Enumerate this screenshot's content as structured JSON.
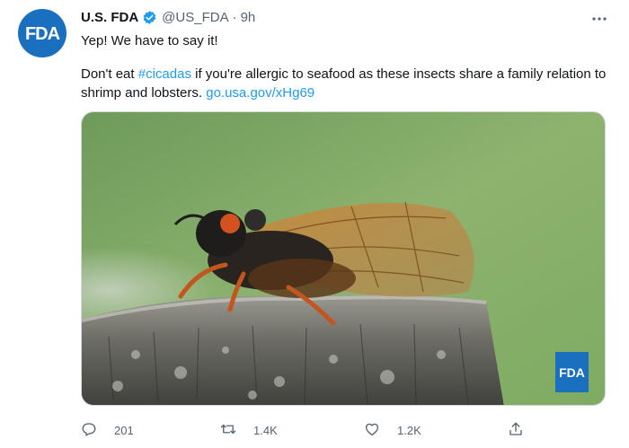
{
  "tweet": {
    "author": {
      "display_name": "U.S. FDA",
      "handle": "@US_FDA",
      "avatar_logo": "FDA",
      "verified_icon": "verified-badge-icon"
    },
    "time_ago": "9h",
    "separator": "·",
    "text_line1": "Yep! We have to say it!",
    "text_line2_start": "Don't eat ",
    "hashtag": "#cicadas",
    "text_line2_rest": " if you're allergic to seafood as these insects share a family relation to shrimp and lobsters. ",
    "url": "go.usa.gov/xHg69",
    "media": {
      "watermark": "FDA"
    },
    "actions": {
      "reply_count": "201",
      "retweet_count": "1.4K",
      "like_count": "1.2K"
    },
    "colors": {
      "link": "#1d9bf0",
      "verified": "#1d9bf0",
      "fda_blue": "#1a6fbf"
    }
  }
}
